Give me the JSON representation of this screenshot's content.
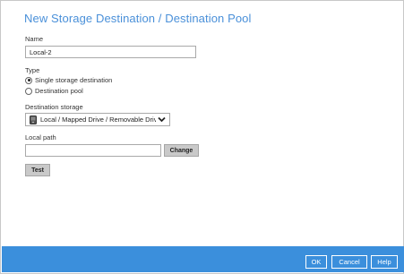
{
  "dialog": {
    "title": "New Storage Destination / Destination Pool"
  },
  "name_field": {
    "label": "Name",
    "value": "Local-2"
  },
  "type": {
    "label": "Type",
    "options": [
      {
        "label": "Single storage destination",
        "selected": true
      },
      {
        "label": "Destination pool",
        "selected": false
      }
    ]
  },
  "destination_storage": {
    "label": "Destination storage",
    "selected": "Local / Mapped Drive / Removable Drive",
    "icon": "drive-icon"
  },
  "local_path": {
    "label": "Local path",
    "value": "",
    "change_label": "Change"
  },
  "test_label": "Test",
  "footer": {
    "ok_label": "OK",
    "cancel_label": "Cancel",
    "help_label": "Help",
    "color": "#3b8fdc"
  },
  "colors": {
    "title": "#4a90d9",
    "button_grey": "#c9c9c9"
  }
}
